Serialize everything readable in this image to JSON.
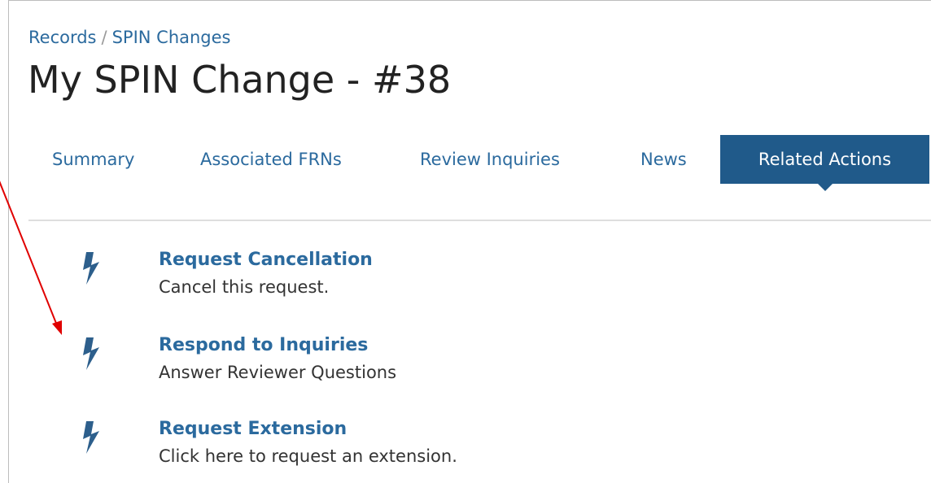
{
  "breadcrumb": {
    "records": "Records",
    "separator": "/",
    "spin_changes": "SPIN Changes"
  },
  "page": {
    "title": "My SPIN Change - #38"
  },
  "tabs": [
    {
      "label": "Summary",
      "active": false
    },
    {
      "label": "Associated FRNs",
      "active": false
    },
    {
      "label": "Review Inquiries",
      "active": false
    },
    {
      "label": "News",
      "active": false
    },
    {
      "label": "Related Actions",
      "active": true
    }
  ],
  "actions": [
    {
      "icon": "lightning-bolt-icon",
      "title": "Request Cancellation",
      "description": "Cancel this request."
    },
    {
      "icon": "lightning-bolt-icon",
      "title": "Respond to Inquiries",
      "description": "Answer Reviewer Questions"
    },
    {
      "icon": "lightning-bolt-icon",
      "title": "Request Extension",
      "description": "Click here to request an extension."
    }
  ],
  "colors": {
    "link": "#2b6a9e",
    "active_tab": "#205a8a",
    "bolt": "#2d5f8c",
    "annotation_arrow": "#e00000",
    "divider": "#dedede"
  }
}
